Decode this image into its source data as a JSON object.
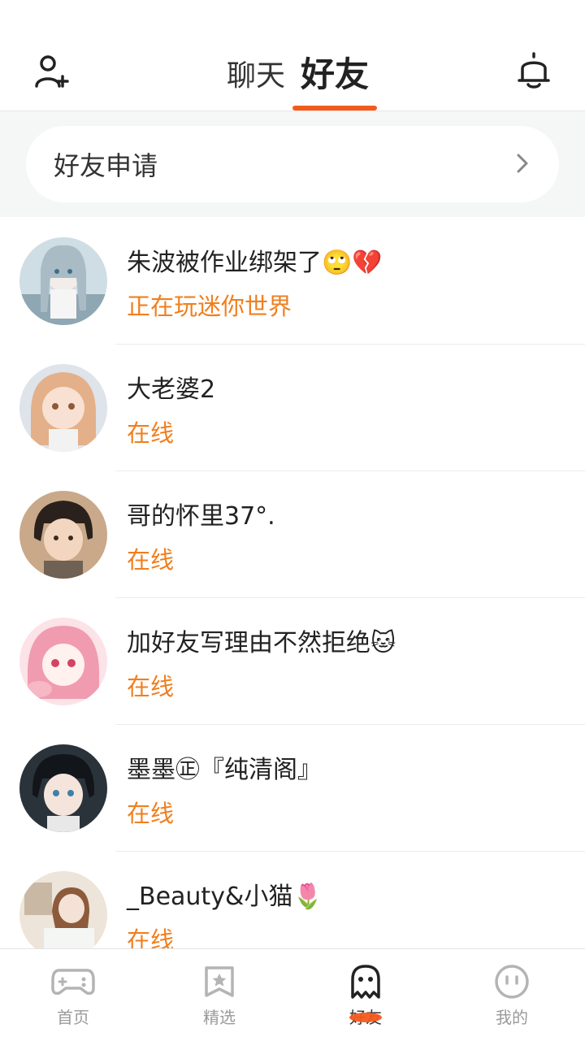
{
  "header": {
    "tabs": [
      {
        "label": "聊天",
        "active": false
      },
      {
        "label": "好友",
        "active": true
      }
    ],
    "add_friend_icon": "add-user-icon",
    "notification_icon": "bell-icon"
  },
  "friend_request": {
    "label": "好友申请",
    "icon": "chevron-right-icon"
  },
  "friends": [
    {
      "name": "朱波被作业绑架了🙄💔",
      "status": "正在玩迷你世界",
      "avatar_color": "#7fa3b8"
    },
    {
      "name": "大老婆2",
      "status": "在线",
      "avatar_color": "#e0a98a"
    },
    {
      "name": "哥的怀里37°.",
      "status": "在线",
      "avatar_color": "#5a4a3a"
    },
    {
      "name": "加好友写理由不然拒绝🐱",
      "status": "在线",
      "avatar_color": "#f3a6b6"
    },
    {
      "name": "墨墨㊣『纯清阁』",
      "status": "在线",
      "avatar_color": "#2f3b45"
    },
    {
      "name": "_Beauty&小猫🌷",
      "status": "在线",
      "avatar_color": "#d9c9b8"
    }
  ],
  "bottom_nav": [
    {
      "label": "首页",
      "icon": "gamepad-icon",
      "active": false
    },
    {
      "label": "精选",
      "icon": "star-icon",
      "active": false
    },
    {
      "label": "好友",
      "icon": "ghost-icon",
      "active": true
    },
    {
      "label": "我的",
      "icon": "face-icon",
      "active": false
    }
  ],
  "colors": {
    "accent": "#f45a1d",
    "status": "#f07f1e",
    "background": "#f5f6f6"
  }
}
